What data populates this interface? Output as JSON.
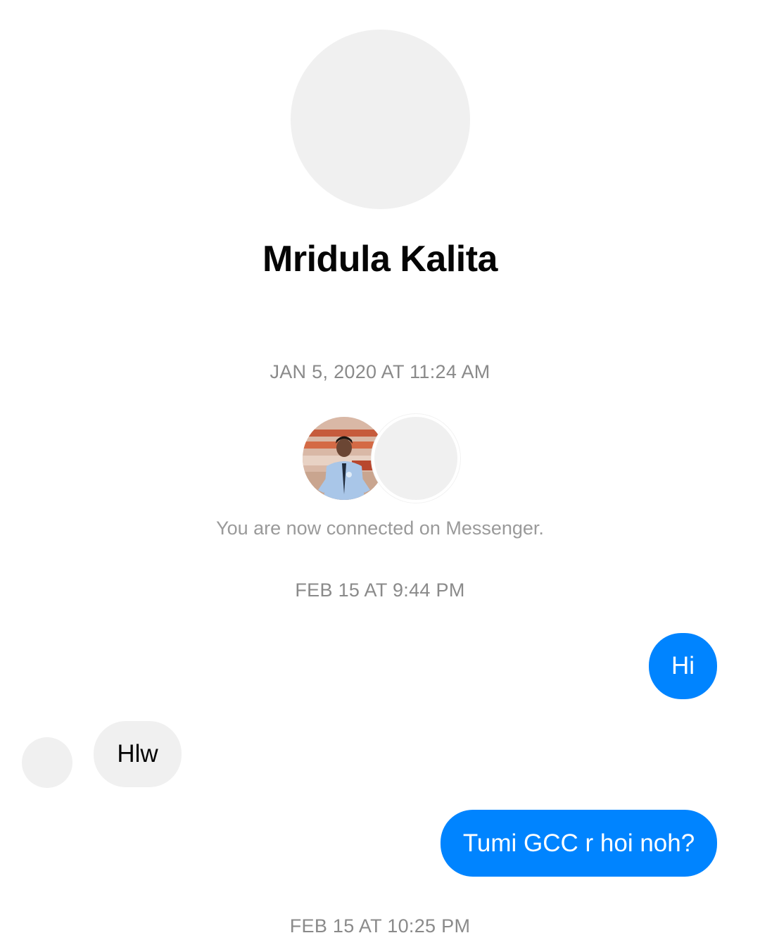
{
  "contact": {
    "name": "Mridula Kalita"
  },
  "thread": {
    "connected_timestamp": "JAN 5, 2020 AT 11:24 AM",
    "connected_note": "You are now connected on Messenger.",
    "timestamp_2": "FEB 15 AT 9:44 PM",
    "timestamp_3": "FEB 15 AT 10:25 PM",
    "messages": [
      {
        "direction": "outgoing",
        "text": "Hi"
      },
      {
        "direction": "incoming",
        "text": "Hlw"
      },
      {
        "direction": "outgoing",
        "text": "Tumi GCC r hoi noh?"
      }
    ]
  },
  "colors": {
    "outgoing_bubble": "#0084ff",
    "incoming_bubble": "#f0f0f0",
    "timestamp_text": "#8a8a8a",
    "placeholder_avatar": "#f0f0f0"
  },
  "icons": {
    "profile_avatar": "placeholder-avatar",
    "connect_user_photo": "user-photo-avatar"
  }
}
